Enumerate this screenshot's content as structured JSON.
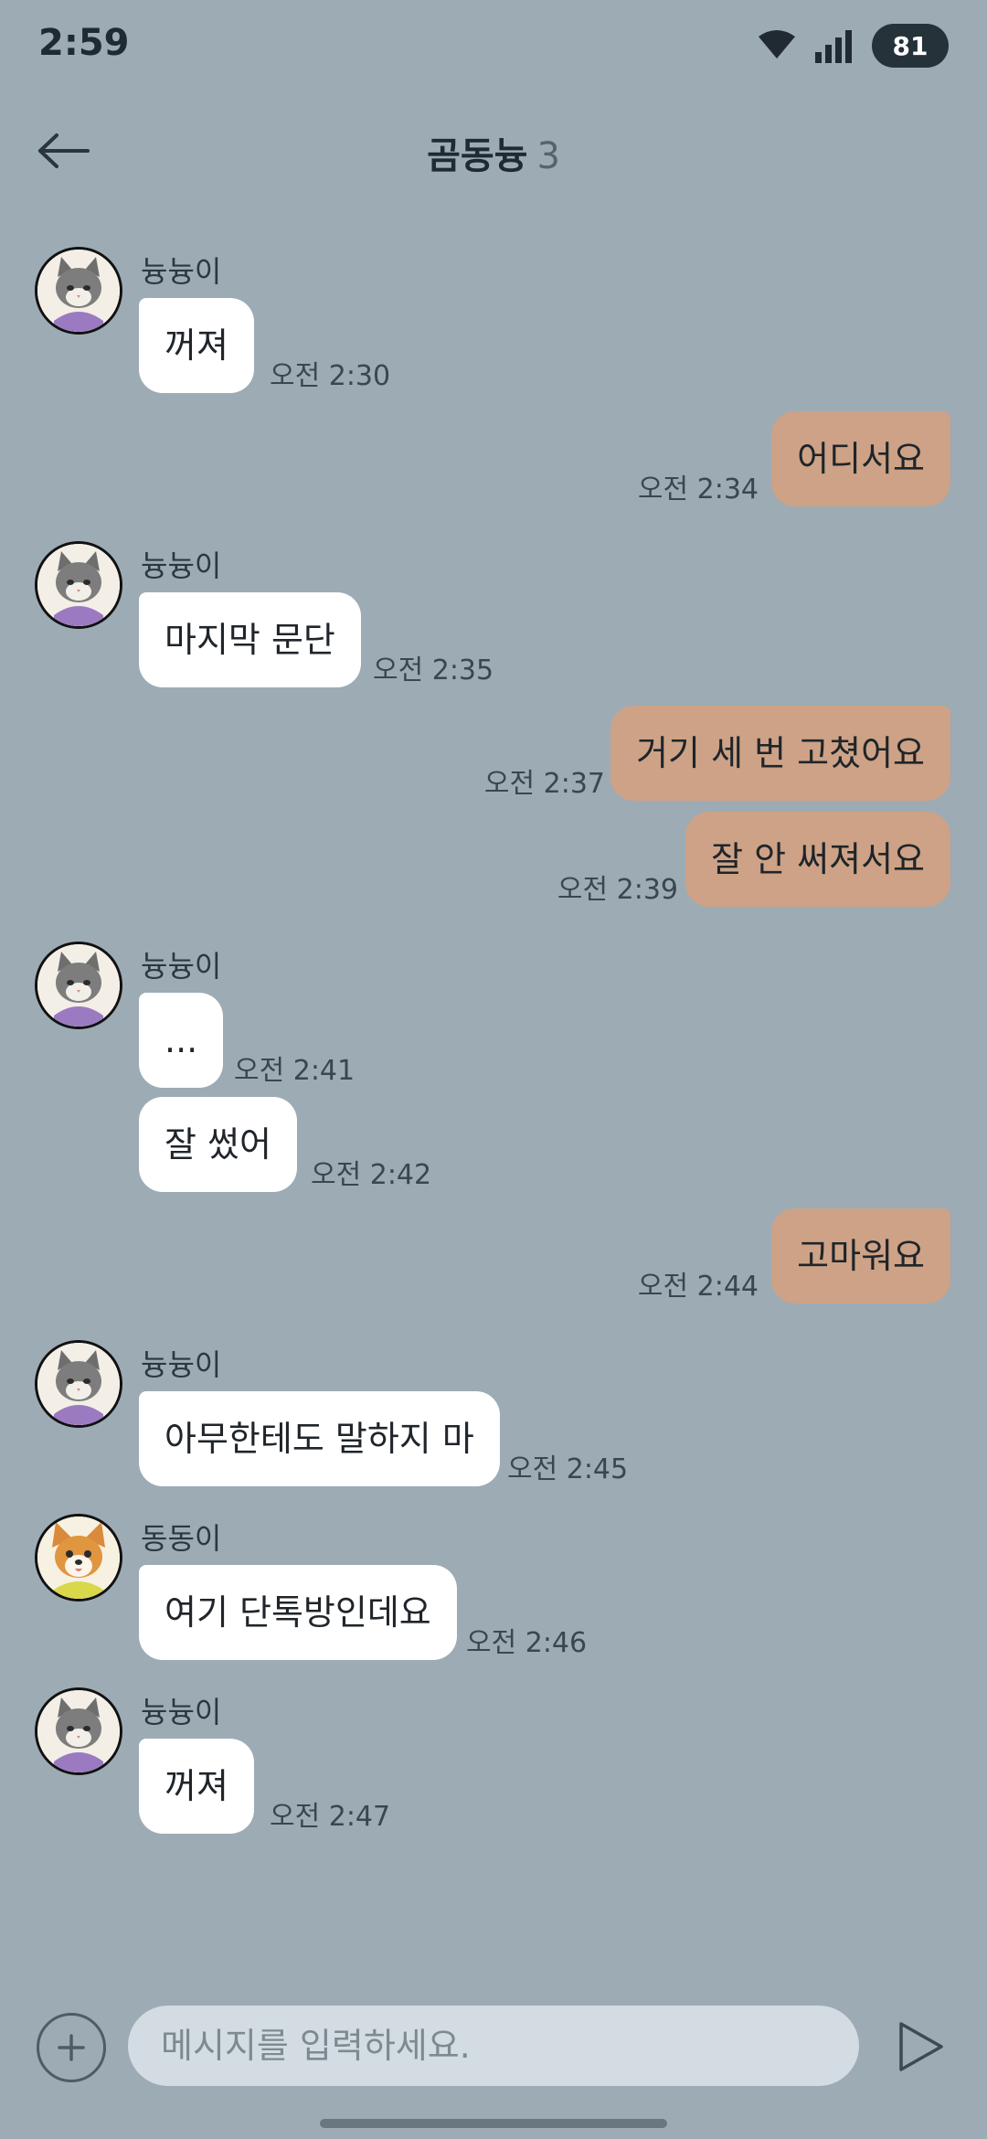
{
  "status_bar": {
    "time": "2:59",
    "battery": "81"
  },
  "header": {
    "title": "곰동늉",
    "member_count": "3"
  },
  "messages": [
    {
      "sender": "늉늉이",
      "text": "꺼져",
      "time": "오전 2:30"
    },
    {
      "text": "어디서요",
      "time": "오전 2:34"
    },
    {
      "sender": "늉늉이",
      "text": "마지막 문단",
      "time": "오전 2:35"
    },
    {
      "text": "거기 세 번 고쳤어요",
      "time": "오전 2:37"
    },
    {
      "text": "잘 안 써져서요",
      "time": "오전 2:39"
    },
    {
      "sender": "늉늉이",
      "text": "...",
      "time": "오전 2:41"
    },
    {
      "text": "잘 썼어",
      "time": "오전 2:42"
    },
    {
      "text": "고마워요",
      "time": "오전 2:44"
    },
    {
      "sender": "늉늉이",
      "text": "아무한테도 말하지 마",
      "time": "오전 2:45"
    },
    {
      "sender": "동동이",
      "text": "여기 단톡방인데요",
      "time": "오전 2:46"
    },
    {
      "sender": "늉늉이",
      "text": "꺼져",
      "time": "오전 2:47"
    }
  ],
  "input": {
    "placeholder": "메시지를 입력하세요."
  },
  "icons": {
    "back": "arrow-left-icon",
    "plus": "plus-icon",
    "send": "send-icon",
    "wifi": "wifi-icon",
    "signal": "signal-icon"
  },
  "colors": {
    "background": "#9DABB5",
    "incoming_bubble": "#FFFFFF",
    "outgoing_bubble": "#CDA286",
    "input_field": "#D3DCE2"
  }
}
